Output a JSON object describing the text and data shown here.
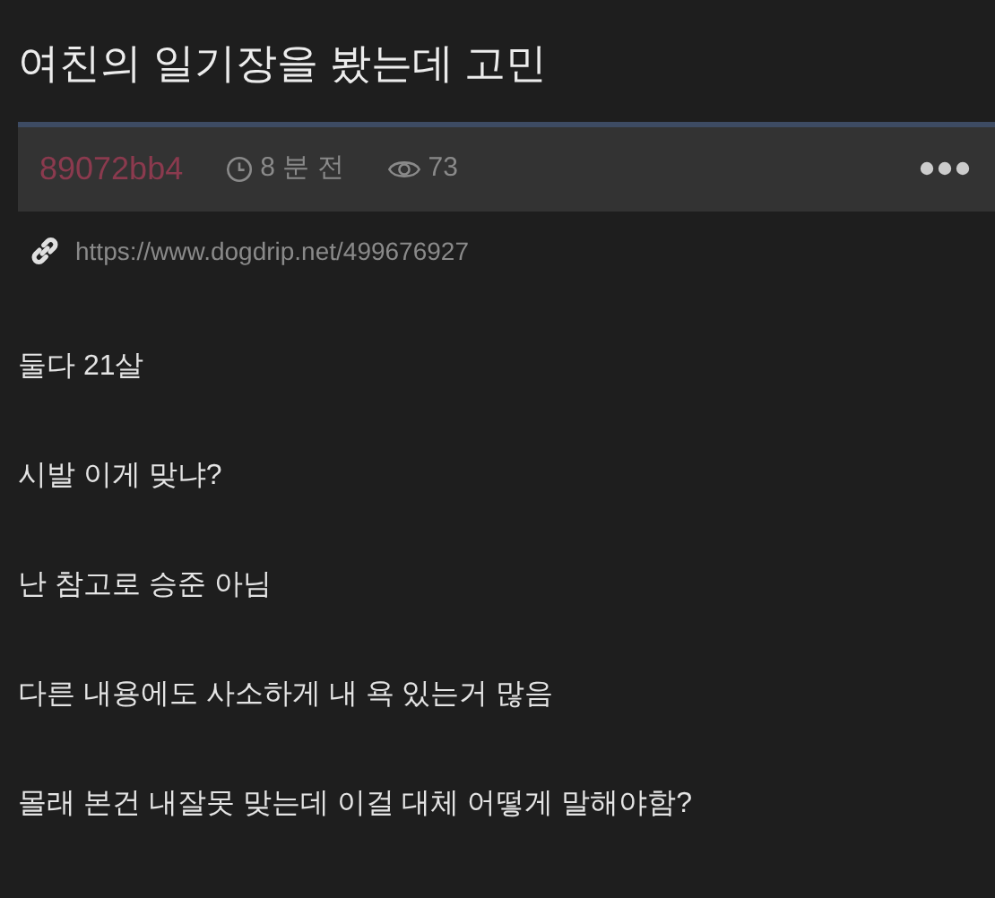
{
  "post": {
    "title": "여친의 일기장을 봤는데 고민",
    "author": "89072bb4",
    "time": "8 분 전",
    "views": "73",
    "url": "https://www.dogdrip.net/499676927",
    "paragraphs": [
      "둘다 21살",
      "시발 이게 맞냐?",
      "난 참고로 승준 아님",
      "다른 내용에도 사소하게 내 욕 있는거 많음",
      "몰래 본건 내잘못 맞는데 이걸 대체 어떻게 말해야함?"
    ]
  }
}
